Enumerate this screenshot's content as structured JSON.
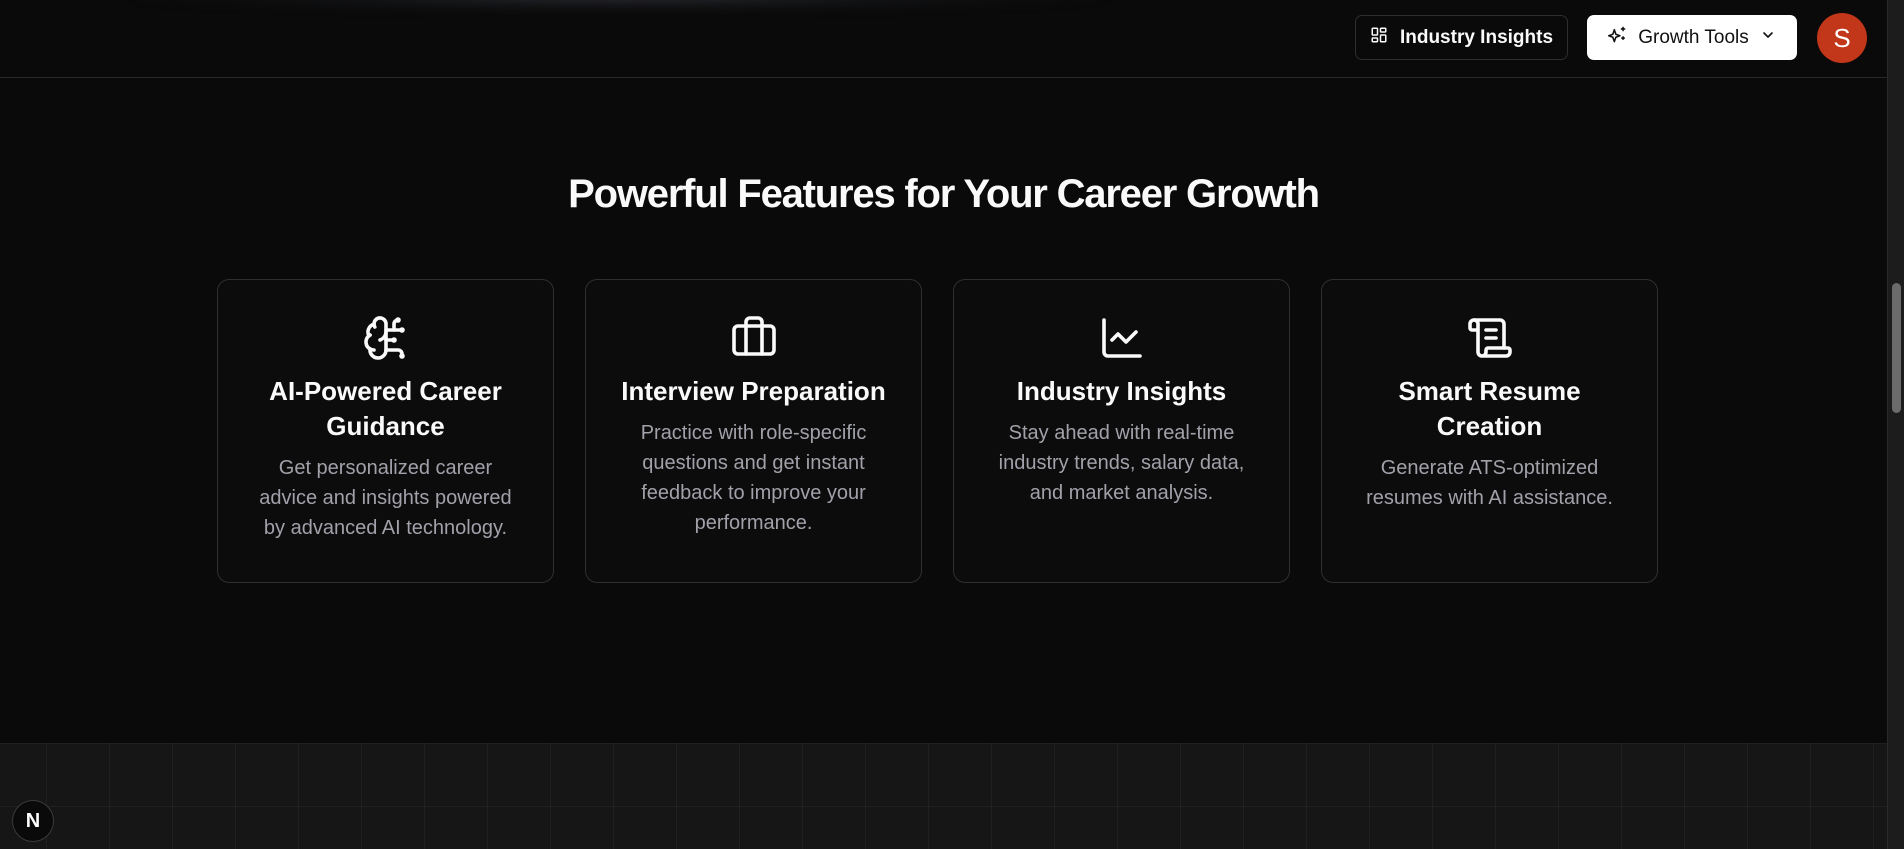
{
  "header": {
    "insights_button": {
      "label": "Industry Insights",
      "icon": "dashboard-icon"
    },
    "growth_button": {
      "label": "Growth Tools",
      "icon": "sparkles-icon",
      "chevron": "chevron-down-icon"
    },
    "avatar": {
      "initial": "S",
      "color": "#c2361a"
    }
  },
  "section": {
    "title": "Powerful Features for Your Career Growth",
    "features": [
      {
        "icon": "brain-circuit-icon",
        "title": "AI-Powered Career Guidance",
        "description": "Get personalized career advice and insights powered by advanced AI technology."
      },
      {
        "icon": "briefcase-icon",
        "title": "Interview Preparation",
        "description": "Practice with role-specific questions and get instant feedback to improve your performance."
      },
      {
        "icon": "line-chart-icon",
        "title": "Industry Insights",
        "description": "Stay ahead with real-time industry trends, salary data, and market analysis."
      },
      {
        "icon": "scroll-text-icon",
        "title": "Smart Resume Creation",
        "description": "Generate ATS-optimized resumes with AI assistance."
      }
    ]
  },
  "badge": {
    "label": "N"
  },
  "colors": {
    "background": "#0a0a0a",
    "card_border": "#2f2f33",
    "muted_text": "#a1a1aa",
    "accent_avatar": "#c2361a"
  }
}
